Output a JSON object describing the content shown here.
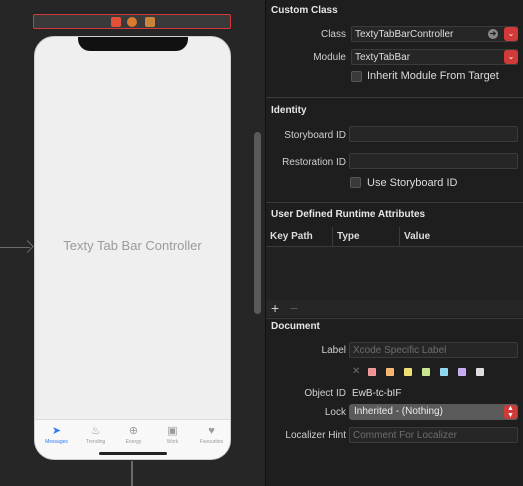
{
  "canvas": {
    "scene_title": "Texty Tab Bar Controller",
    "tabs": [
      {
        "label": "Messages",
        "icon": "paper-plane-icon"
      },
      {
        "label": "Trending",
        "icon": "flame-icon"
      },
      {
        "label": "Energy",
        "icon": "plus-circle-icon"
      },
      {
        "label": "Work",
        "icon": "briefcase-icon"
      },
      {
        "label": "Favourites",
        "icon": "heart-icon"
      }
    ],
    "scene_bar_icons": [
      "view-controller-icon",
      "first-responder-icon",
      "exit-icon"
    ]
  },
  "inspector": {
    "custom_class": {
      "title": "Custom Class",
      "class_label": "Class",
      "class_value": "TextyTabBarController",
      "module_label": "Module",
      "module_value": "TextyTabBar",
      "inherit_label": "Inherit Module From Target"
    },
    "identity": {
      "title": "Identity",
      "storyboard_id_label": "Storyboard ID",
      "storyboard_id_value": "",
      "restoration_id_label": "Restoration ID",
      "restoration_id_value": "",
      "use_storyboard_id_label": "Use Storyboard ID"
    },
    "udra": {
      "title": "User Defined Runtime Attributes",
      "columns": [
        "Key Path",
        "Type",
        "Value"
      ],
      "add": "+",
      "remove": "−"
    },
    "document": {
      "title": "Document",
      "label_label": "Label",
      "label_placeholder": "Xcode Specific Label",
      "object_id_label": "Object ID",
      "object_id_value": "EwB-tc-bIF",
      "lock_label": "Lock",
      "lock_value": "Inherited - (Nothing)",
      "localizer_label": "Localizer Hint",
      "localizer_placeholder": "Comment For Localizer",
      "swatch_clear": "✕",
      "swatches": [
        "#f09090",
        "#f5b26b",
        "#f0dc6b",
        "#c8e68a",
        "#8ad6f0",
        "#c4a8f0",
        "#dcdcdc"
      ]
    }
  }
}
